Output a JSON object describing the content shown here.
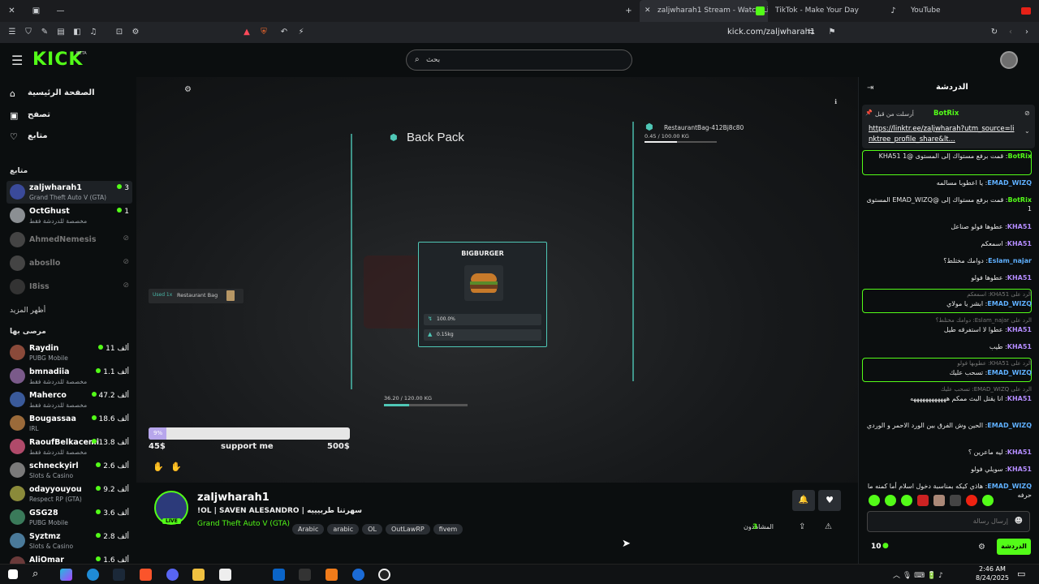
{
  "browser": {
    "tabs": [
      {
        "label": "zaljwharah1 Stream - Watch Li…",
        "active": true
      },
      {
        "label": "TikTok - Make Your Day"
      },
      {
        "label": "YouTube"
      }
    ],
    "address": "kick.com/zaljwharah1"
  },
  "header": {
    "logo": "KICK",
    "logo_badge": "BETA",
    "search_placeholder": "بحث"
  },
  "sidebar": {
    "nav": [
      "الصفحة الرئيسية",
      "تصفح",
      "متابع"
    ],
    "following_title": "متابع",
    "following": [
      {
        "name": "zaljwharah1",
        "sub": "Grand Theft Auto V (GTA)",
        "count": "3",
        "live": true
      },
      {
        "name": "OctGhust",
        "sub": "مخصصة للدردشة فقط",
        "count": "1",
        "live": true
      },
      {
        "name": "AhmedNemesis",
        "live": false
      },
      {
        "name": "abosllo",
        "live": false
      },
      {
        "name": "I8iss",
        "live": false
      }
    ],
    "show_more": "أظهر المزيد",
    "recommended_title": "مرصى بها",
    "recommended": [
      {
        "name": "Raydin",
        "sub": "PUBG Mobile",
        "count": "11 ألف"
      },
      {
        "name": "bmnadiia",
        "sub": "مخصصة للدردشة فقط",
        "count": "1.1 ألف"
      },
      {
        "name": "Maherco",
        "sub": "مخصصة للدردشة فقط",
        "count": "47.2 ألف"
      },
      {
        "name": "Bougassaa",
        "sub": "IRL",
        "count": "18.6 ألف"
      },
      {
        "name": "RaoufBelkacemi",
        "sub": "مخصصة للدردشة فقط",
        "count": "13.8 ألف"
      },
      {
        "name": "schneckyirl",
        "sub": "Slots & Casino",
        "count": "2.6 ألف"
      },
      {
        "name": "odayyouyou",
        "sub": "Respect RP (GTA)",
        "count": "9.2 ألف"
      },
      {
        "name": "GSG28",
        "sub": "PUBG Mobile",
        "count": "3.6 ألف"
      },
      {
        "name": "Syztmz",
        "sub": "Slots & Casino",
        "count": "2.8 ألف"
      },
      {
        "name": "AliOmar",
        "sub": "",
        "count": "1.6 ألف"
      }
    ]
  },
  "player": {
    "backpack_title": "Back Pack",
    "restaurant_bag": "RestaurantBag-412Bj8c80",
    "bag_weight": "0.45 / 100.00 KG",
    "bag_fill": 0.45,
    "used_label": "Used 1x",
    "used_item": "Restaurant Bag",
    "item_name": "BIGBURGER",
    "item_quality": "100.0%",
    "item_weight": "0.15kg",
    "inv_weight": "36.20 / 120.00 KG",
    "inv_fill": 0.3,
    "goal_percent": "9%",
    "goal_fill": 0.09,
    "goal_current": "45$",
    "goal_label": "support me",
    "goal_target": "500$"
  },
  "stream": {
    "channel": "zaljwharah1",
    "live_badge": "LIVE",
    "title": "!OL | SAVEN ALESANDRO | سهرتنا طربيييه",
    "category": "Grand Theft Auto V (GTA)",
    "tags": [
      "Arabic",
      "arabic",
      "OL",
      "OutLawRP",
      "fivem"
    ],
    "viewers_label": "المشاهدون",
    "viewers": "3"
  },
  "chat": {
    "title": "الدردشة",
    "pinned_by": "أرسلت من قبل",
    "pinned_user": "BotRix",
    "pinned_link": "https://linktr.ee/zaljwharah?utm_source=linktree_profile_share&lt...",
    "messages": [
      {
        "user": "BotRix",
        "text": "قمت برفع مستواك إلى المستوى @KHA51 1",
        "cls": "u-bot",
        "boxed": true
      },
      {
        "user": "EMAD_WIZQ",
        "text": "يا اعطوبا مسالمه",
        "cls": "u-emad"
      },
      {
        "user": "BotRix",
        "text": "قمت برفع مستواك إلى @EMAD_WIZQ المستوى 1",
        "cls": "u-bot"
      },
      {
        "user": "KHA51",
        "text": "عطوها فولو صناعل",
        "cls": "u-kha"
      },
      {
        "user": "KHA51",
        "text": "اسمعكم",
        "cls": "u-kha"
      },
      {
        "user": "Eslam_najar",
        "text": "دوامك مختلط؟",
        "cls": "u-emad"
      },
      {
        "user": "KHA51",
        "text": "عطوها فولو",
        "cls": "u-kha"
      },
      {
        "user": "EMAD_WIZQ",
        "text": "ابشر يا مولاي",
        "cls": "u-emad",
        "reply": "الرد على KHA51: اسمعكم",
        "boxed": true
      },
      {
        "user": "KHA51",
        "text": "عطوا لا استفرقه طيل",
        "cls": "u-kha",
        "reply": "الرد على Eslam_najar: دوامك مختلط؟"
      },
      {
        "user": "KHA51",
        "text": "طيب",
        "cls": "u-kha"
      },
      {
        "user": "EMAD_WIZQ",
        "text": "تسحب عليك",
        "cls": "u-emad",
        "reply": "الرد على KHA51: عطوبها فولو",
        "boxed": true
      },
      {
        "user": "KHA51",
        "text": "انا يقتل البث ممكم ههههههههههههه",
        "cls": "u-kha",
        "reply": "الرد على EMAD_WIZQ: تسحب عليك"
      },
      {
        "user": "EMAD_WIZQ",
        "text": "الحين وش الفرق بين الورد الاحمر و الوردي",
        "cls": "u-emad"
      },
      {
        "user": "KHA51",
        "text": "ليه ماعرين ؟",
        "cls": "u-kha"
      },
      {
        "user": "KHA51",
        "text": "سويلي فولو",
        "cls": "u-kha"
      },
      {
        "user": "EMAD_WIZQ",
        "text": "هاذي كيكه بمناسبة دخول اسلام أما كمنه ما حرفه",
        "cls": "u-emad"
      }
    ],
    "input_placeholder": "إرسال رسالة",
    "points": "10",
    "send_label": "الدردشة"
  },
  "taskbar": {
    "time": "2:46 AM",
    "date": "8/24/2025"
  }
}
